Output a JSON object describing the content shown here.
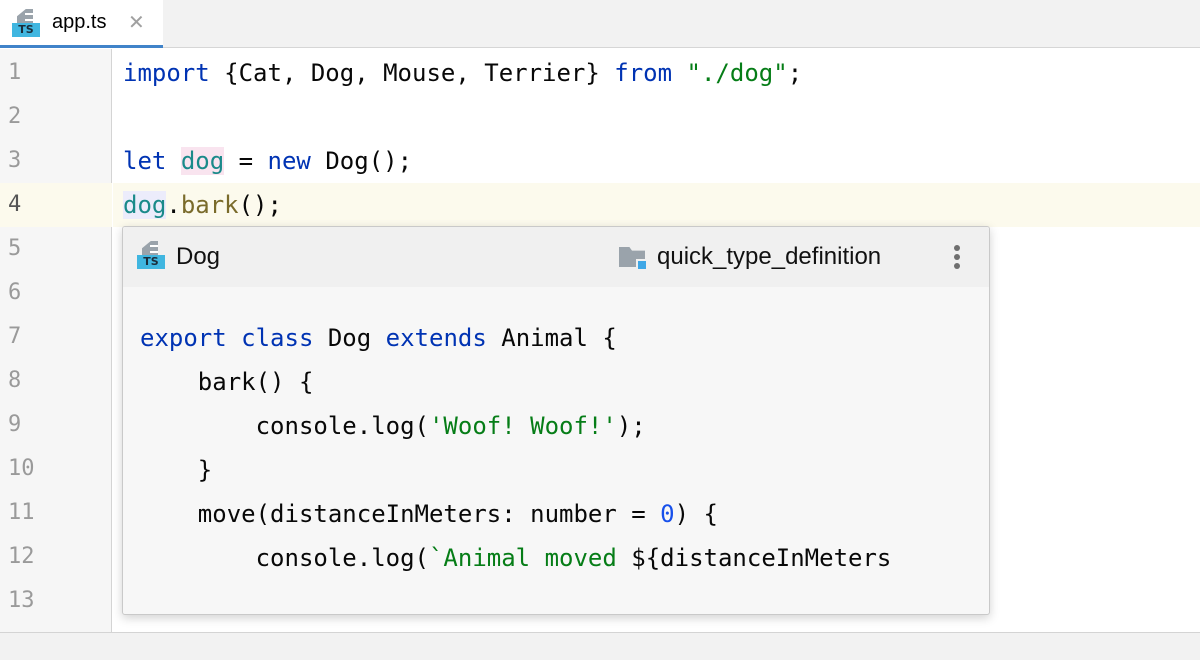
{
  "tab": {
    "icon": "typescript-file-icon",
    "icon_badge": "TS",
    "label": "app.ts",
    "close_glyph": "✕"
  },
  "gutter": {
    "line_numbers": [
      "1",
      "2",
      "3",
      "4",
      "5",
      "6",
      "7",
      "8",
      "9",
      "10",
      "11",
      "12",
      "13"
    ],
    "current_line": "4"
  },
  "editor": {
    "line1": {
      "kw_import": "import",
      "braces": " {Cat, Dog, Mouse, Terrier} ",
      "kw_from": "from",
      "space": " ",
      "path": "\"./dog\"",
      "semi": ";"
    },
    "line3": {
      "kw_let": "let",
      "sp1": " ",
      "var": "dog",
      "eq": " = ",
      "kw_new": "new",
      "rest": " Dog();"
    },
    "line4": {
      "var": "dog",
      "dot": ".",
      "method": "bark",
      "rest": "();"
    }
  },
  "popup": {
    "icon": "typescript-file-icon",
    "icon_badge": "TS",
    "title": "Dog",
    "module_icon": "module-folder-icon",
    "module_name": "quick_type_definition",
    "menu_icon": "more-vertical-icon",
    "code": {
      "l1": {
        "kw_export": "export",
        "sp1": " ",
        "kw_class": "class",
        "name": " Dog ",
        "kw_extends": "extends",
        "rest": " Animal {"
      },
      "l2": {
        "text": "    bark() {"
      },
      "l3": {
        "pre": "        console.log(",
        "str": "'Woof! Woof!'",
        "post": ");"
      },
      "l4": {
        "text": "    }"
      },
      "l5": {
        "pre": "    move(distanceInMeters: number = ",
        "num": "0",
        "post": ") {"
      },
      "l6": {
        "pre": "        console.log(",
        "str": "`Animal moved ",
        "post": "${distanceInMeters"
      }
    }
  },
  "colors": {
    "keyword": "#0033b3",
    "string": "#067d17",
    "variable": "#1a8a8a",
    "method": "#7a6b2b",
    "number": "#1750eb",
    "caret_row": "#fcfaed",
    "ts_badge": "#40b6e0"
  }
}
